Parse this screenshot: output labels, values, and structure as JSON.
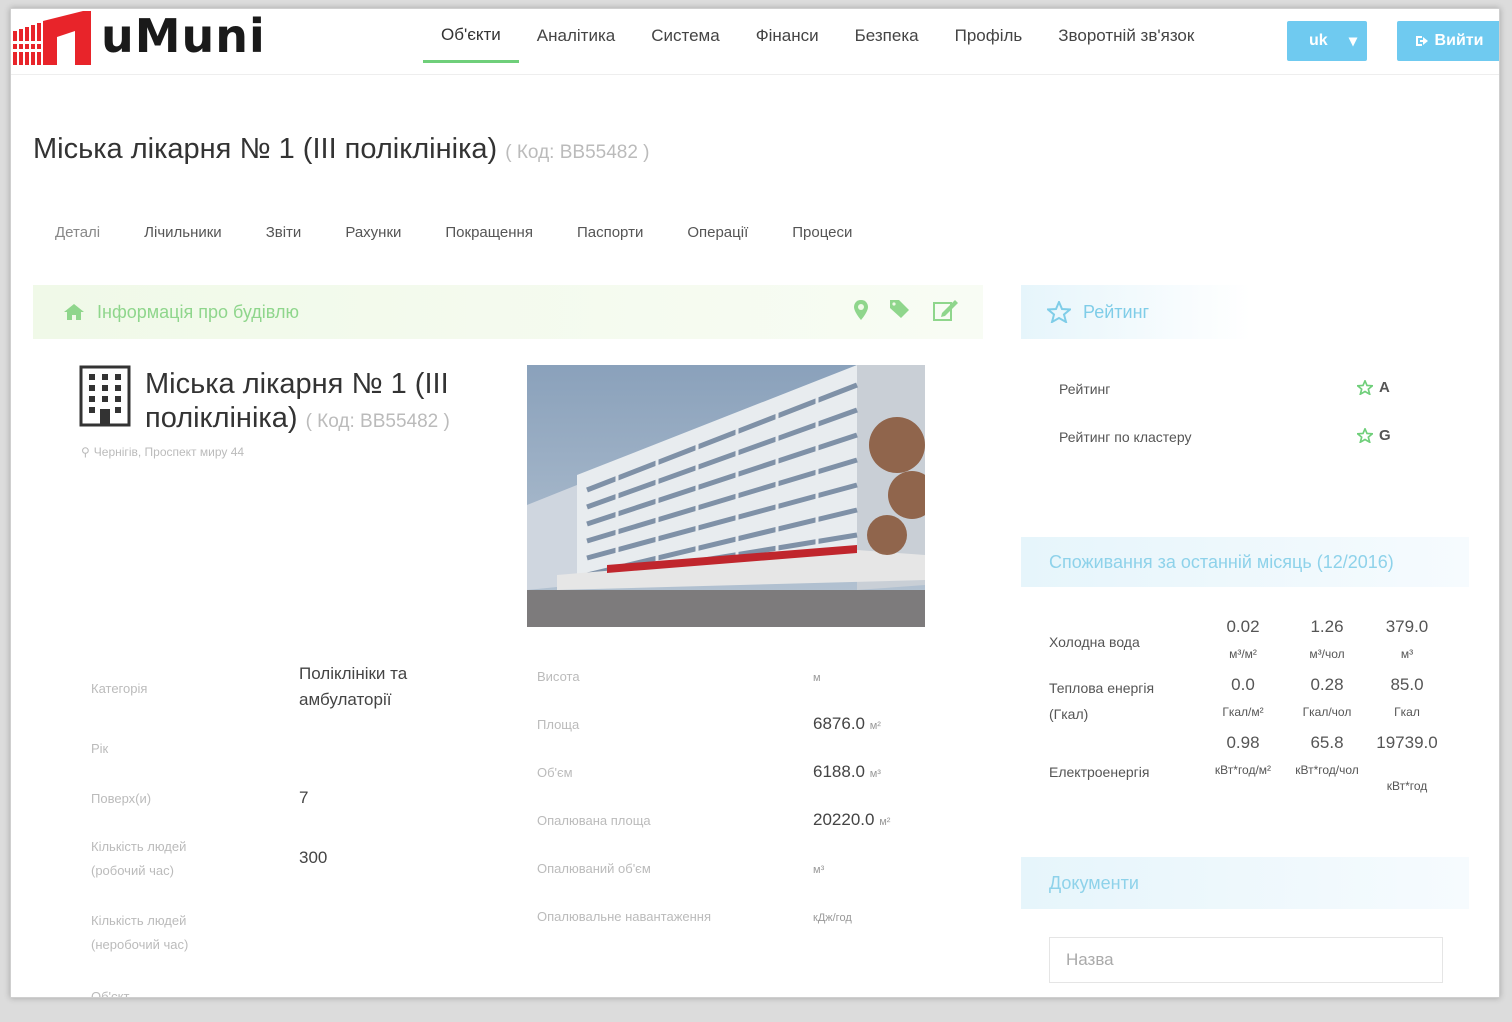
{
  "brand": {
    "name": "uMuni"
  },
  "nav": {
    "items": [
      "Об'єкти",
      "Аналітика",
      "Система",
      "Фінанси",
      "Безпека",
      "Профіль",
      "Зворотній зв'язок"
    ],
    "lang": "uk",
    "logout": "Вийти"
  },
  "page": {
    "title": "Міська лікарня № 1 (ІІІ поліклініка)",
    "code": "( Код: BB55482 )"
  },
  "tabs": [
    "Деталі",
    "Лічильники",
    "Звіти",
    "Рахунки",
    "Покращення",
    "Паспорти",
    "Операції",
    "Процеси"
  ],
  "info": {
    "header": "Інформація про будівлю",
    "name": "Міська лікарня № 1 (ІІІ поліклініка)",
    "code": "( Код: BB55482 )",
    "address": "Чернігів, Проспект миру 44"
  },
  "details_left": [
    {
      "label": "Категорія",
      "value": "Поліклініки та амбулаторії"
    },
    {
      "label": "Рік",
      "value": ""
    },
    {
      "label": "Поверх(и)",
      "value": "7"
    },
    {
      "label": "Кількість людей (робочий час)",
      "value": "300"
    },
    {
      "label": "Кількість людей (неробочий час)",
      "value": ""
    },
    {
      "label": "Об'єкт",
      "value": ""
    }
  ],
  "details_right": [
    {
      "label": "Висота",
      "value": "",
      "unit": "м"
    },
    {
      "label": "Площа",
      "value": "6876.0",
      "unit": "м²"
    },
    {
      "label": "Об'єм",
      "value": "6188.0",
      "unit": "м³"
    },
    {
      "label": "Опалювана площа",
      "value": "20220.0",
      "unit": "м²"
    },
    {
      "label": "Опалюваний об'єм",
      "value": "",
      "unit": "м³"
    },
    {
      "label": "Опалювальне навантаження",
      "value": "",
      "unit": "кДж/год"
    }
  ],
  "rating": {
    "header": "Рейтинг",
    "rows": [
      {
        "label": "Рейтинг",
        "value": "A"
      },
      {
        "label": "Рейтинг по кластеру",
        "value": "G"
      }
    ]
  },
  "consumption": {
    "header": "Споживання за останній місяць (12/2016)",
    "rows": [
      {
        "label": "Холодна вода",
        "cells": [
          {
            "num": "0.02",
            "unit": "м³/м²"
          },
          {
            "num": "1.26",
            "unit": "м³/чол"
          },
          {
            "num": "379.0",
            "unit": "м³"
          }
        ]
      },
      {
        "label": "Теплова енергія (Гкал)",
        "cells": [
          {
            "num": "0.0",
            "unit": "Гкал/м²"
          },
          {
            "num": "0.28",
            "unit": "Гкал/чол"
          },
          {
            "num": "85.0",
            "unit": "Гкал"
          }
        ]
      },
      {
        "label": "Електроенергія",
        "cells": [
          {
            "num": "0.98",
            "unit": "кВт*год/м²"
          },
          {
            "num": "65.8",
            "unit": "кВт*год/чол"
          },
          {
            "num": "19739.0",
            "unit": "кВт*год"
          }
        ]
      }
    ]
  },
  "documents": {
    "header": "Документи",
    "placeholder": "Назва"
  },
  "colors": {
    "accent_green": "#6fcf7a",
    "accent_blue": "#6fcaf0",
    "logo_red": "#e8242a"
  },
  "icons": [
    "home-icon",
    "map-marker-icon",
    "tags-icon",
    "edit-icon",
    "star-icon",
    "building-icon",
    "sign-out-icon",
    "caret-down-icon"
  ]
}
